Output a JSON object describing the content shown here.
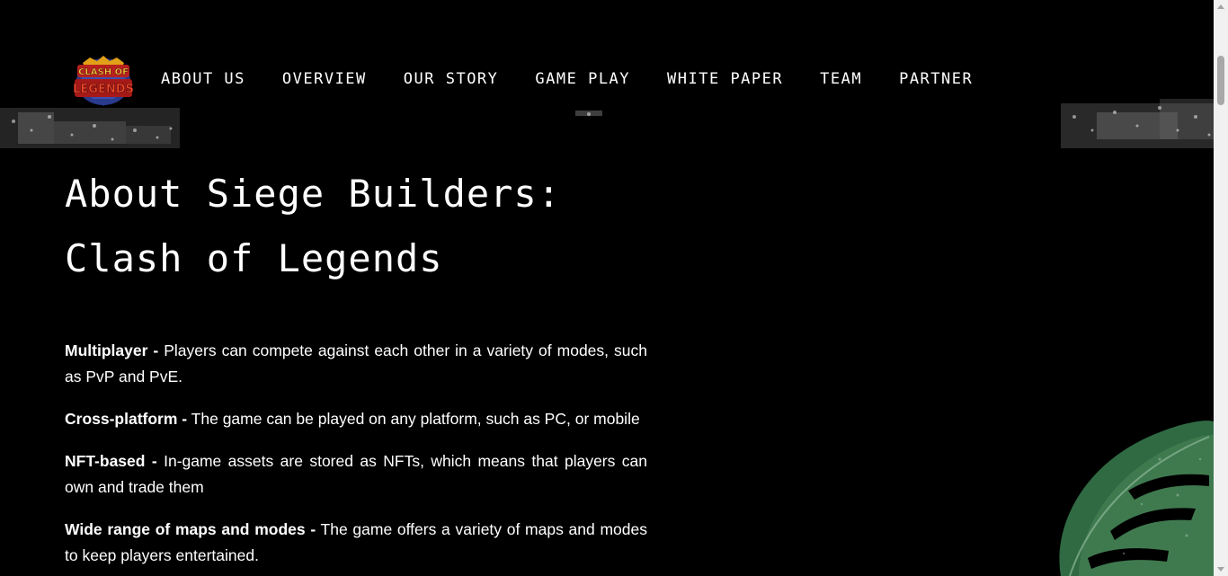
{
  "logo": {
    "text_line1": "CLASH OF",
    "text_line2": "LEGENDS"
  },
  "nav": {
    "items": [
      {
        "label": "ABOUT US"
      },
      {
        "label": "OVERVIEW"
      },
      {
        "label": "OUR STORY"
      },
      {
        "label": "GAME PLAY"
      },
      {
        "label": "WHITE PAPER"
      },
      {
        "label": "TEAM"
      },
      {
        "label": "PARTNER"
      }
    ]
  },
  "main": {
    "title": "About Siege Builders: Clash of Legends",
    "features": [
      {
        "term": "Multiplayer -",
        "text": "Players can compete against each other in a variety of modes, such as PvP and PvE."
      },
      {
        "term": "Cross-platform -",
        "text": "The game can be played on any platform, such as PC, or mobile"
      },
      {
        "term": "NFT-based -",
        "text": "In-game assets are stored as NFTs, which means that players can own and trade them"
      },
      {
        "term": "Wide range of maps and modes -",
        "text": "The game offers a variety of maps and modes to keep players entertained."
      }
    ]
  },
  "colors": {
    "background": "#000000",
    "text": "#ffffff",
    "leaf": "#3f7a4f"
  }
}
